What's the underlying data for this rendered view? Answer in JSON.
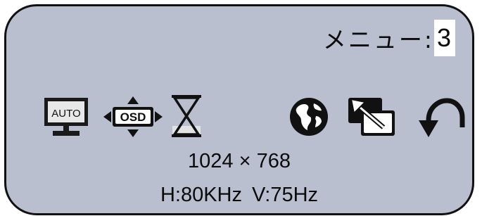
{
  "menu": {
    "label": "メニュー:",
    "number": "3"
  },
  "icons": [
    {
      "name": "auto-adjust-icon",
      "text": "AUTO"
    },
    {
      "name": "osd-position-icon",
      "text": "OSD"
    },
    {
      "name": "osd-timeout-icon"
    },
    {
      "name": "language-icon"
    },
    {
      "name": "input-select-icon"
    },
    {
      "name": "reset-icon"
    }
  ],
  "status": {
    "resolution": "1024 × 768",
    "h_freq": "H:80KHz",
    "v_freq": "V:75Hz"
  },
  "colors": {
    "panel_bg": "#b9bfce",
    "border": "#111111",
    "highlight": "#ffffff"
  }
}
